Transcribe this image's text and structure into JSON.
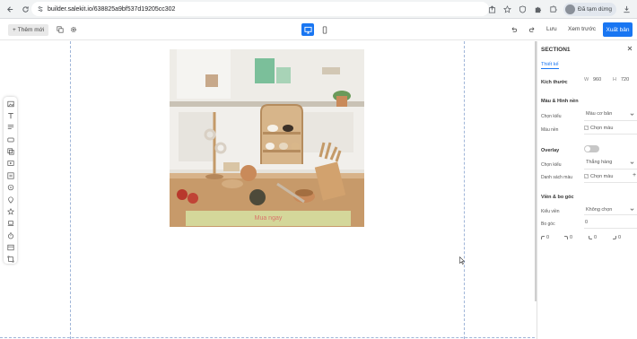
{
  "browser": {
    "url": "builder.salekit.io/638825a9bf537d19205cc302",
    "profile_label": "Đã tạm dừng"
  },
  "toolbar": {
    "add_label": "Thêm mới",
    "save_label": "Lưu",
    "preview_label": "Xem trước",
    "publish_label": "Xuất bản"
  },
  "canvas": {
    "cta_label": "Mua ngay",
    "colors": {
      "cta_bg": "#d4d79a",
      "cta_text": "#d9736a"
    }
  },
  "panel": {
    "title": "SECTION1",
    "tab_design": "Thiết kế",
    "size_label": "Kích thước",
    "width_prefix": "W",
    "width_value": "960",
    "height_prefix": "H",
    "height_value": "720",
    "color_section": "Màu & Hình nền",
    "choose_type_label": "Chọn kiểu",
    "bg_type_value": "Màu cơ bản",
    "bg_color_label": "Màu nền",
    "bg_color_value": "Chọn màu",
    "overlay_section": "Overlay",
    "overlay_type_label": "Chọn kiểu",
    "overlay_type_value": "Thẳng hàng",
    "color_list_label": "Danh sách màu",
    "color_list_value": "Chọn màu",
    "border_section": "Viền & bo góc",
    "border_type_label": "Kiểu viền",
    "border_type_value": "Không chọn",
    "radius_label": "Bo góc",
    "radius_value": "0",
    "corners": [
      "0",
      "0",
      "0",
      "0"
    ]
  },
  "accent_color": "#1976f2"
}
